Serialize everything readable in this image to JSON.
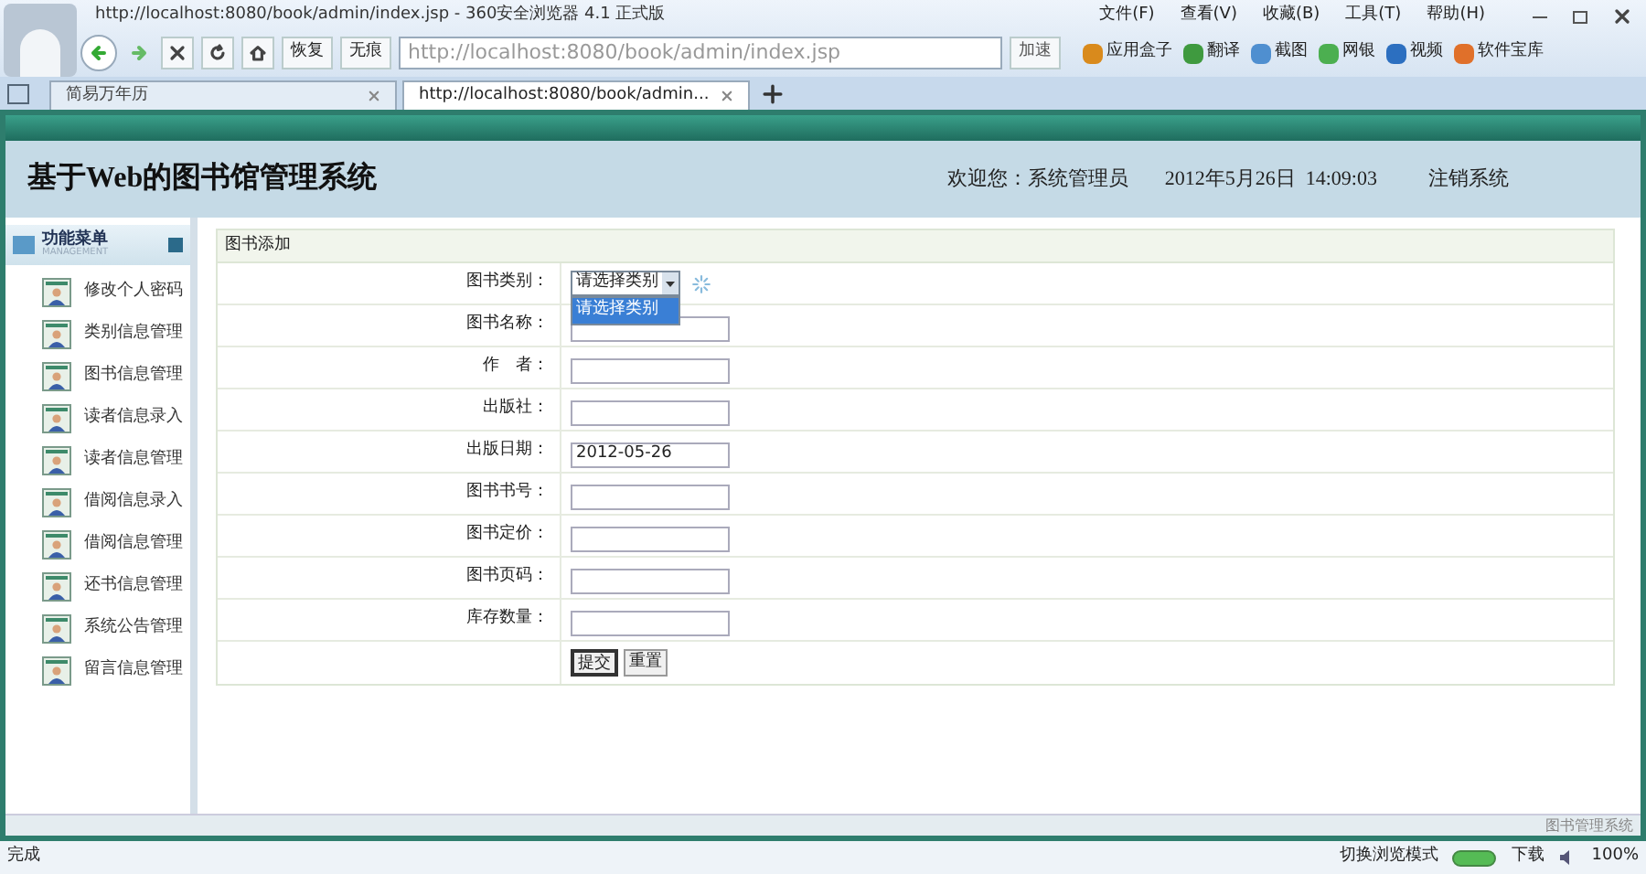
{
  "window": {
    "title": "http://localhost:8080/book/admin/index.jsp - 360安全浏览器 4.1 正式版"
  },
  "menu": [
    "文件(F)",
    "查看(V)",
    "收藏(B)",
    "工具(T)",
    "帮助(H)"
  ],
  "toolbar": {
    "restore": "恢复",
    "incognito": "无痕",
    "address": "http://localhost:8080/book/admin/index.jsp",
    "speed": "加速",
    "apps": [
      {
        "label": "应用盒子",
        "color": "#d98a1c"
      },
      {
        "label": "翻译",
        "color": "#3f9a3f"
      },
      {
        "label": "截图",
        "color": "#4f8fd0"
      },
      {
        "label": "网银",
        "color": "#4caf50"
      },
      {
        "label": "视频",
        "color": "#2c6fc0"
      },
      {
        "label": "软件宝库",
        "color": "#e0702a"
      }
    ]
  },
  "tabs": [
    {
      "label": "简易万年历",
      "selected": false
    },
    {
      "label": "http://localhost:8080/book/admin...",
      "selected": true
    }
  ],
  "header": {
    "title": "基于Web的图书馆管理系统",
    "welcome": "欢迎您：系统管理员",
    "datetime": "2012年5月26日  14:09:03",
    "logout": "注销系统"
  },
  "sidebar": {
    "title": "功能菜单",
    "subtitle": "MANAGEMENT",
    "items": [
      "修改个人密码",
      "类别信息管理",
      "图书信息管理",
      "读者信息录入",
      "读者信息管理",
      "借阅信息录入",
      "借阅信息管理",
      "还书信息管理",
      "系统公告管理",
      "留言信息管理"
    ]
  },
  "form": {
    "title": "图书添加",
    "fields": [
      {
        "label": "图书类别：",
        "kind": "select",
        "value": "请选择类别",
        "open": true,
        "options": [
          {
            "label": "请选择类别",
            "selected": true
          }
        ]
      },
      {
        "label": "图书名称：",
        "kind": "text"
      },
      {
        "label": "作　者：",
        "kind": "text"
      },
      {
        "label": "出版社：",
        "kind": "text"
      },
      {
        "label": "出版日期：",
        "kind": "text",
        "value": "2012-05-26"
      },
      {
        "label": "图书书号：",
        "kind": "text"
      },
      {
        "label": "图书定价：",
        "kind": "text"
      },
      {
        "label": "图书页码：",
        "kind": "text"
      },
      {
        "label": "库存数量：",
        "kind": "text"
      }
    ],
    "buttons": [
      "提交",
      "重置"
    ]
  },
  "footer": "图书管理系统",
  "status_bar": {
    "status": "完成",
    "mode": "切换浏览模式",
    "download": "下载",
    "zoom": "100%"
  }
}
